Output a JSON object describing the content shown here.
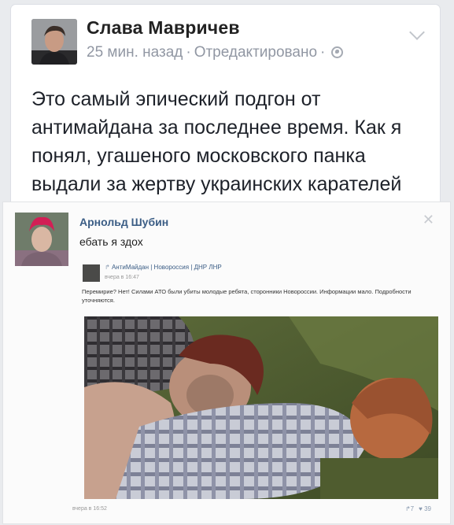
{
  "post": {
    "author_name": "Слава Мавричев",
    "time": "25 мин. назад",
    "edited": "Отредактировано",
    "separator": "·",
    "text": "Это самый эпический подгон от антимайдана за последнее время. Как я понял, угашеного московского панка выдали за жертву украинских карателей",
    "icons": {
      "avatar": "user-photo",
      "privacy": "globe-icon",
      "menu": "chevron-down-icon"
    }
  },
  "vk": {
    "author_name": "Арнольд Шубин",
    "comment": "ебать я здох",
    "close": "✕",
    "repost": {
      "source": "АнтиМайдан | Новороссия | ДНР ЛНР",
      "arrow": "↱",
      "date": "вчера в 16:47",
      "text": "Перемирие? Нет! Силами АТО были убиты молодые ребята, сторонники Новороссии. Информации мало. Подробности уточняются."
    },
    "footer": {
      "date": "вчера в 16:52",
      "reposts": "↱7",
      "likes": "♥ 39"
    }
  },
  "colors": {
    "page_bg": "#e9ebee",
    "vk_link": "#3b5d85",
    "meta_gray": "#9197a3"
  }
}
